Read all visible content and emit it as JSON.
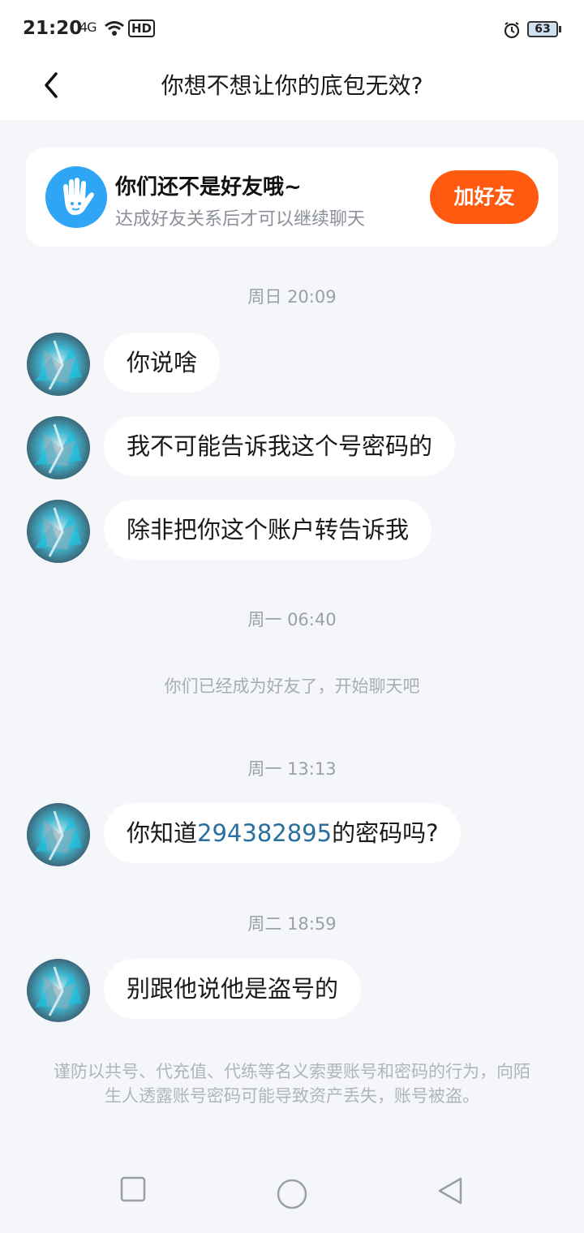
{
  "status_bar": {
    "time": "21:20",
    "signal": "4G",
    "hd": "HD",
    "battery": "63"
  },
  "header": {
    "title": "你想不想让你的底包无效?"
  },
  "friend_banner": {
    "title": "你们还不是好友哦~",
    "subtitle": "达成好友关系后才可以继续聊天",
    "button_label": "加好友",
    "accent_color": "#ff5a0f"
  },
  "chat": {
    "time_1": "周日 20:09",
    "msg_1": "你说啥",
    "msg_2": "我不可能告诉我这个号密码的",
    "msg_3": "除非把你这个账户转告诉我",
    "time_2": "周一 06:40",
    "system_note": "你们已经成为好友了，开始聊天吧",
    "time_3": "周一 13:13",
    "msg_4_prefix": "你知道",
    "msg_4_number": "294382895",
    "msg_4_suffix": "的密码吗?",
    "time_4": "周二 18:59",
    "msg_5": "别跟他说他是盗号的"
  },
  "warning": {
    "text": "谨防以共号、代充值、代练等名义索要账号和密码的行为，向陌生人透露账号密码可能导致资产丢失，账号被盗。"
  },
  "icons": {
    "back": "chevron-left-icon",
    "recent": "square-icon",
    "home": "circle-icon",
    "back_sys": "triangle-back-icon"
  }
}
